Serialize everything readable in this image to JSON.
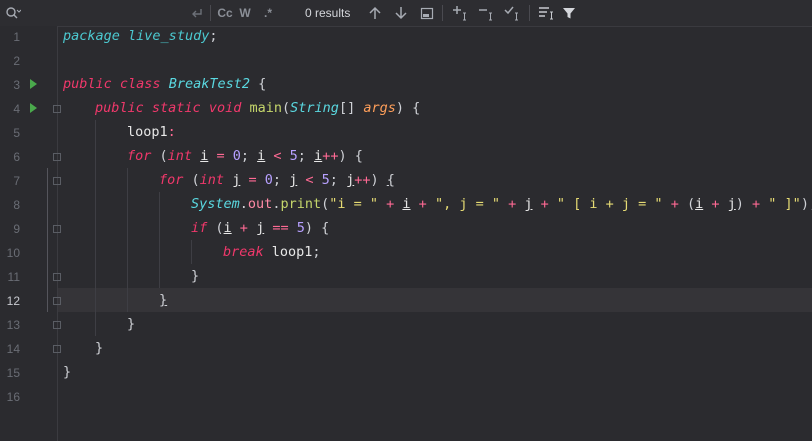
{
  "toolbar": {
    "search_icon": "search-icon",
    "results": "0 results",
    "match_case": "Cc",
    "words": "W",
    "regex": ".*"
  },
  "lines": [
    {
      "n": "1"
    },
    {
      "n": "2"
    },
    {
      "n": "3"
    },
    {
      "n": "4"
    },
    {
      "n": "5"
    },
    {
      "n": "6"
    },
    {
      "n": "7"
    },
    {
      "n": "8"
    },
    {
      "n": "9"
    },
    {
      "n": "10"
    },
    {
      "n": "11"
    },
    {
      "n": "12"
    },
    {
      "n": "13"
    },
    {
      "n": "14"
    },
    {
      "n": "15"
    },
    {
      "n": "16"
    }
  ],
  "current_line": "12",
  "code": {
    "l1_kw": "package",
    "l1_pkg": "live_study",
    "l1_semi": ";",
    "l3_kw1": "public",
    "l3_kw2": "class",
    "l3_cls": "BreakTest2",
    "l3_brace": " {",
    "l4_kw1": "public",
    "l4_kw2": "static",
    "l4_kw3": "void",
    "l4_fn": "main",
    "l4_p1": "(",
    "l4_type": "String",
    "l4_arr": "[] ",
    "l4_param": "args",
    "l4_p2": ") {",
    "l5_label": "loop1",
    "l5_colon": ":",
    "l6_for": "for",
    "l6_a": " (",
    "l6_int": "int",
    "l6_i1": "i",
    "l6_eq": " = ",
    "l6_zero": "0",
    "l6_s1": "; ",
    "l6_i2": "i",
    "l6_lt": " < ",
    "l6_five": "5",
    "l6_s2": "; ",
    "l6_i3": "i",
    "l6_pp": "++",
    "l6_end": ") {",
    "l7_for": "for",
    "l7_a": " (",
    "l7_int": "int",
    "l7_j1": "j",
    "l7_eq": " = ",
    "l7_zero": "0",
    "l7_s1": "; ",
    "l7_j2": "j",
    "l7_lt": " < ",
    "l7_five": "5",
    "l7_s2": "; ",
    "l7_j3": "j",
    "l7_pp": "++",
    "l7_end": ") ",
    "l7_brace": "{",
    "l8_sys": "System",
    "l8_dot1": ".",
    "l8_out": "out",
    "l8_dot2": ".",
    "l8_print": "print",
    "l8_p": "(",
    "l8_s1": "\"i = \"",
    "l8_plus1": " + ",
    "l8_i": "i",
    "l8_plus2": " + ",
    "l8_s2": "\", j = \"",
    "l8_plus3": " + ",
    "l8_j": "j",
    "l8_plus4": " + ",
    "l8_s3": "\" [ i + j = \"",
    "l8_plus5": " + ",
    "l8_p2": "(",
    "l8_i2": "i",
    "l8_plus6": " + ",
    "l8_j2": "j",
    "l8_p3": ")",
    "l8_plus7": " + ",
    "l8_s4": "\" ]\"",
    "l8_end": ");",
    "l9_if": "if",
    "l9_a": " (",
    "l9_i": "i",
    "l9_plus": " + ",
    "l9_j": "j",
    "l9_eqeq": " == ",
    "l9_five": "5",
    "l9_end": ") {",
    "l10_break": "break",
    "l10_label": " loop1",
    "l10_semi": ";",
    "l11": "}",
    "l12": "}",
    "l13": "}",
    "l14": "}",
    "l15": "}"
  }
}
